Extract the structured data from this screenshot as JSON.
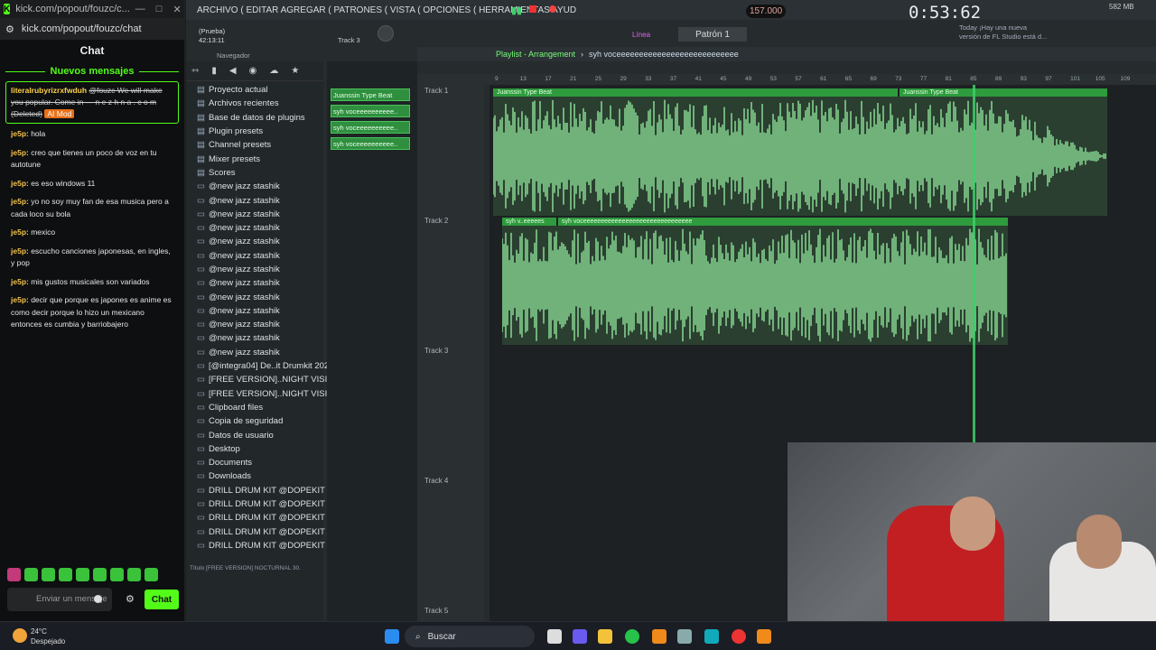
{
  "kick": {
    "tab_url": "kick.com/popout/fouzc/c...",
    "address": "kick.com/popout/fouzc/chat",
    "header": "Chat",
    "new_messages": "Nuevos mensajes",
    "pinned": {
      "user": "literalrubyrizrxfwduh",
      "text": "@fouzc We will make you popular. Come in — n e z h n a . c o m (Deleted)",
      "tag": "AI Mod"
    },
    "messages": [
      {
        "user": "je5p",
        "text": "hola"
      },
      {
        "user": "je5p",
        "text": "creo que tienes un poco de voz en tu autotune"
      },
      {
        "user": "je5p",
        "text": "es eso windows 11"
      },
      {
        "user": "je5p",
        "text": "yo no soy muy fan de esa musica pero a cada loco su bola"
      },
      {
        "user": "je5p",
        "text": "mexico"
      },
      {
        "user": "je5p",
        "text": "escucho canciones japonesas, en ingles, y pop"
      },
      {
        "user": "je5p",
        "text": "mis gustos musicales son variados"
      },
      {
        "user": "je5p",
        "text": "decir que porque es japones es anime es como decir porque lo hizo un mexicano entonces es cumbia y barriobajero"
      }
    ],
    "input_placeholder": "Enviar un mensaje",
    "send_label": "Chat"
  },
  "fl": {
    "menu": "ARCHIVO ( EDITAR AGREGAR ( PATRONES ( VISTA ( OPCIONES ( HERRAMIENTAS AYUD",
    "tempo": "157.000",
    "timer": "0:53:62",
    "cpu_mem": "582 MB",
    "song_name": "(Prueba)",
    "time_small": "42:13:11",
    "hint": "Track 3",
    "pattern": "Patrón 1",
    "snap": "Línea",
    "news": "Today ¡Hay una nueva versión de FL Studio está d...",
    "playlist_title": "Playlist - Arrangement",
    "playlist_clip": "syh voceeeeeeeeeeeeeeeeeeeeeeeeeee",
    "browser_label": "Navegador",
    "browser_items": [
      "Proyecto actual",
      "Archivos recientes",
      "Base de datos de plugins",
      "Plugin presets",
      "Channel presets",
      "Mixer presets",
      "Scores",
      "@new jazz stashik",
      "@new jazz stashik",
      "@new jazz stashik",
      "@new jazz stashik",
      "@new jazz stashik",
      "@new jazz stashik",
      "@new jazz stashik",
      "@new jazz stashik",
      "@new jazz stashik",
      "@new jazz stashik",
      "@new jazz stashik",
      "@new jazz stashik",
      "@new jazz stashik",
      "[@integra04] De..it Drumkit 2023",
      "[FREE VERSION]..NIGHT VISION",
      "[FREE VERSION]..NIGHT VISION",
      "Clipboard files",
      "Copia de seguridad",
      "Datos de usuario",
      "Desktop",
      "Documents",
      "Downloads",
      "DRILL DRUM KIT @DOPEKIT",
      "DRILL DRUM KIT @DOPEKIT",
      "DRILL DRUM KIT @DOPEKIT",
      "DRILL DRUM KIT @DOPEKIT",
      "DRILL DRUM KIT @DOPEKIT"
    ],
    "browser_footer": "Título  [FREE VERSION] NOCTURNAL 30.",
    "channels": [
      "Juanssin Type Beat",
      "syh voceeeeeeeeee..",
      "syh voceeeeeeeeee..",
      "syh voceeeeeeeeee.."
    ],
    "tracks": [
      "Track 1",
      "Track 2",
      "Track 3",
      "Track 4",
      "Track 5"
    ],
    "ruler": [
      "9",
      "13",
      "17",
      "21",
      "25",
      "29",
      "33",
      "37",
      "41",
      "45",
      "49",
      "53",
      "57",
      "61",
      "65",
      "69",
      "73",
      "77",
      "81",
      "85",
      "89",
      "93",
      "97",
      "101",
      "105",
      "109"
    ],
    "clips": {
      "t1a": "Juanssin Type Beat",
      "t1b": "Juanssin Type Beat",
      "t2a": "syh v..eeeees",
      "t2b": "syh voceeeeeeeeeeeeeeeeeeeeeeeeeeeeeee"
    }
  },
  "taskbar": {
    "temp": "24°C",
    "weather": "Despejado",
    "search": "Buscar"
  },
  "colors": {
    "kick_green": "#53fc18",
    "fl_clip": "#2e9b3d",
    "wave": "#8fe49a"
  }
}
